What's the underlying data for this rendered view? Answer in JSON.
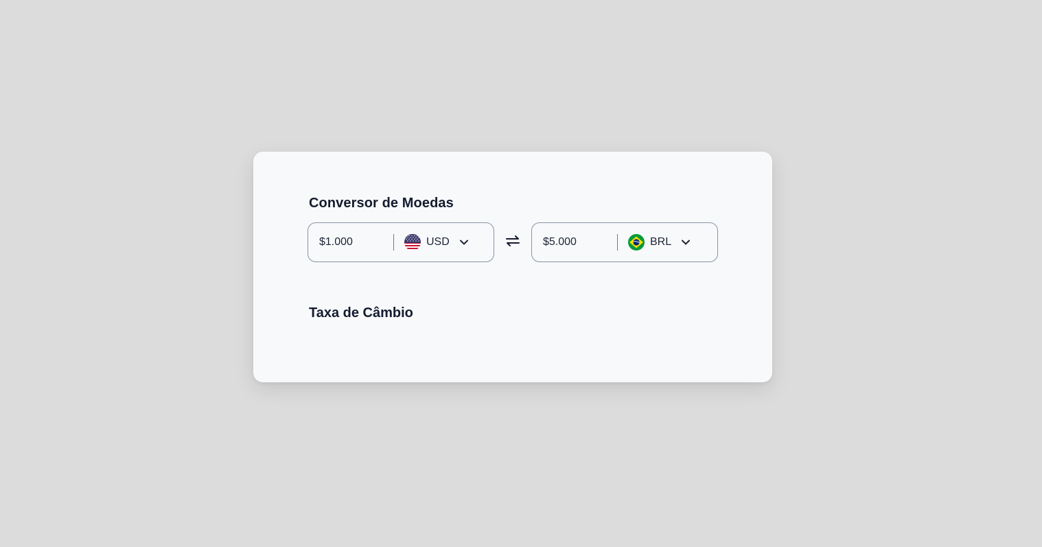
{
  "converter": {
    "title": "Conversor de Moedas",
    "from": {
      "amount": "$1.000",
      "currency": "USD",
      "flag_icon": "us-flag-icon"
    },
    "to": {
      "amount": "$5.000",
      "currency": "BRL",
      "flag_icon": "br-flag-icon"
    },
    "swap_icon": "swap-arrows-icon",
    "rate_title": "Taxa de Câmbio"
  },
  "colors": {
    "background": "#dcdcdc",
    "card": "#f7f9fb",
    "text": "#141b2d",
    "border": "#8a93a3"
  }
}
